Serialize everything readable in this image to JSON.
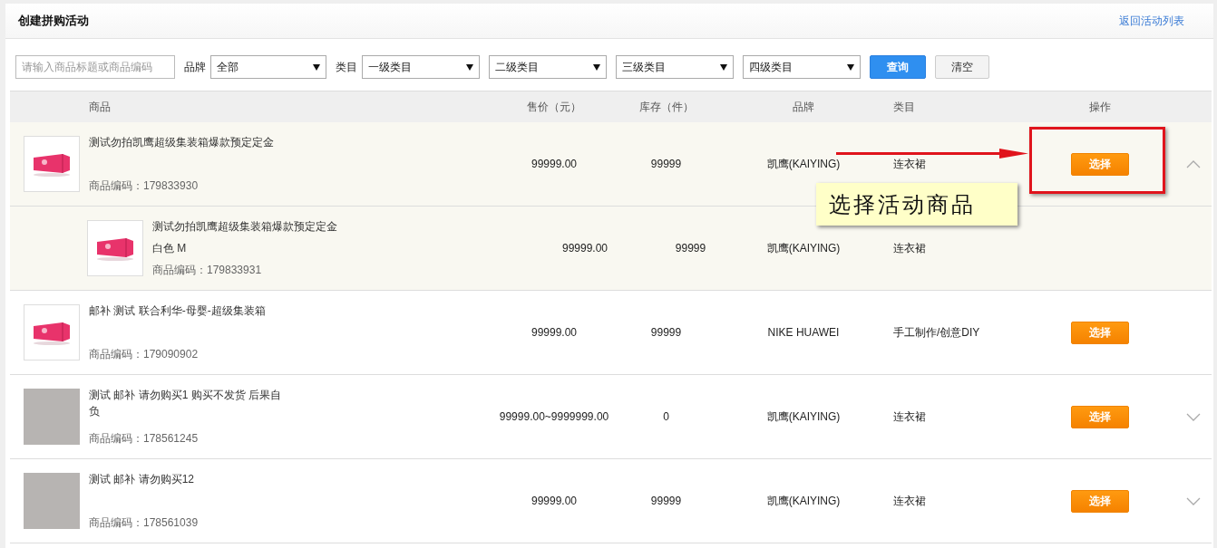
{
  "header": {
    "title": "创建拼购活动",
    "back_link": "返回活动列表"
  },
  "filters": {
    "search": {
      "placeholder": "请输入商品标题或商品编码"
    },
    "brand_label": "品牌",
    "brand_select": "全部",
    "category_label": "类目",
    "category_selects": [
      "一级类目",
      "二级类目",
      "三级类目",
      "四级类目"
    ],
    "query_button": "查询",
    "clear_button": "清空"
  },
  "table": {
    "columns": [
      "商品",
      "售价（元）",
      "库存（件）",
      "品牌",
      "类目",
      "操作"
    ],
    "rows": [
      {
        "kind": "container",
        "title": "测试勿拍凯鹰超级集装箱爆款预定定金",
        "code": "商品编码：179833930",
        "price": "99999.00",
        "stock": "99999",
        "brand": "凯鹰(KAIYING)",
        "category": "连衣裙",
        "action": "选择",
        "expanded": true,
        "children": [
          {
            "kind": "container",
            "title": "测试勿拍凯鹰超级集装箱爆款预定定金",
            "spec": "白色 M",
            "code": "商品编码：179833931",
            "price": "99999.00",
            "stock": "99999",
            "brand": "凯鹰(KAIYING)",
            "category": "连衣裙"
          }
        ]
      },
      {
        "kind": "container",
        "title": "邮补 测试 联合利华-母婴-超级集装箱",
        "code": "商品编码：179090902",
        "price": "99999.00",
        "stock": "99999",
        "brand": "NIKE HUAWEI",
        "category": "手工制作/创意DIY",
        "action": "选择"
      },
      {
        "kind": "photo",
        "title": "测试 邮补 请勿购买1 购买不发货 后果自负",
        "code": "商品编码：178561245",
        "price": "99999.00~9999999.00",
        "stock": "0",
        "brand": "凯鹰(KAIYING)",
        "category": "连衣裙",
        "action": "选择",
        "expanded": false
      },
      {
        "kind": "photo",
        "title": "测试 邮补 请勿购买12",
        "code": "商品编码：178561039",
        "price": "99999.00",
        "stock": "99999",
        "brand": "凯鹰(KAIYING)",
        "category": "连衣裙",
        "action": "选择",
        "expanded": false
      }
    ]
  },
  "annotation": {
    "callout": "选择活动商品"
  }
}
